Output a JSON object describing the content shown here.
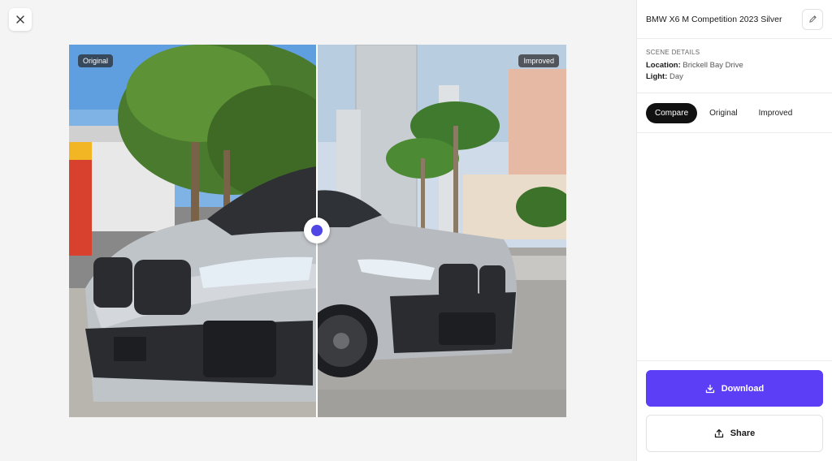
{
  "window": {
    "close_icon": "close-icon"
  },
  "viewer": {
    "original_tag": "Original",
    "improved_tag": "Improved",
    "slider_accent": "#4f46e5"
  },
  "panel": {
    "title": "BMW X6 M Competition 2023 Silver",
    "edit_icon": "pencil-icon",
    "scene_details": {
      "heading": "SCENE DETAILS",
      "location_label": "Location:",
      "location_value": "Brickell Bay Drive",
      "light_label": "Light:",
      "light_value": "Day"
    },
    "tabs": [
      {
        "label": "Compare",
        "active": true
      },
      {
        "label": "Original",
        "active": false
      },
      {
        "label": "Improved",
        "active": false
      }
    ],
    "download_label": "Download",
    "share_label": "Share",
    "accent": "#5b3ef6"
  }
}
